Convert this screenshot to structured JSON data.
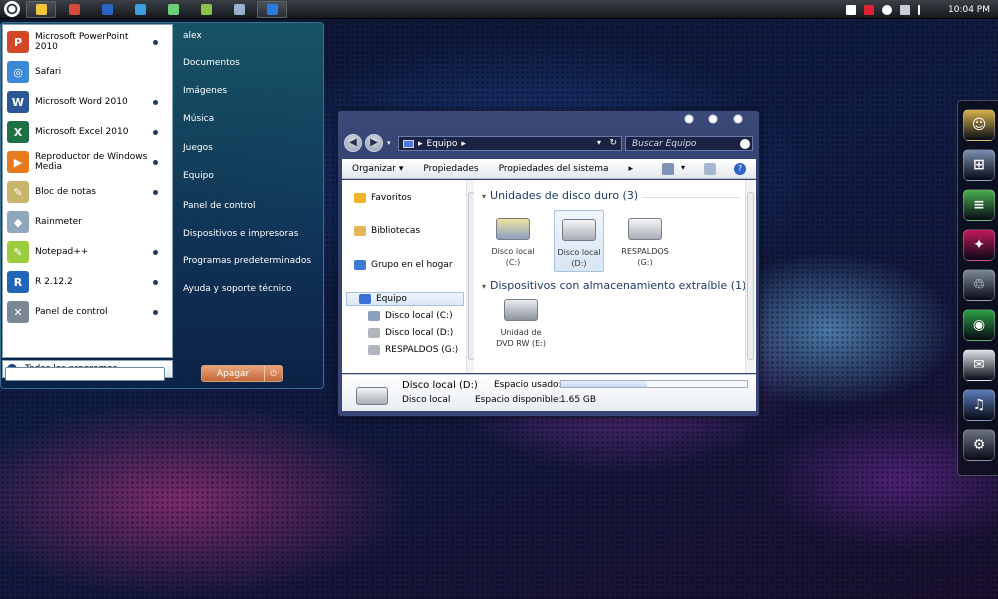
{
  "taskbar": {
    "buttons": [
      {
        "name": "taskbar-notes-button",
        "color": "#f2c73a",
        "active": true
      },
      {
        "name": "taskbar-paint-button",
        "color": "#d24a3a",
        "active": false
      },
      {
        "name": "taskbar-photoshop-button",
        "color": "#2a64c4",
        "active": false
      },
      {
        "name": "taskbar-vector-button",
        "color": "#3aa0e0",
        "active": false
      },
      {
        "name": "taskbar-math-button",
        "color": "#6ad07a",
        "active": false
      },
      {
        "name": "taskbar-tool-button",
        "color": "#8bc34a",
        "active": false
      },
      {
        "name": "taskbar-dots-button",
        "color": "#9ab0d0",
        "active": false
      },
      {
        "name": "taskbar-ps-button",
        "color": "#2a7de0",
        "active": true
      }
    ],
    "clock": "10:04 PM"
  },
  "start_menu": {
    "programs": [
      {
        "label": "Microsoft PowerPoint 2010",
        "icon": "powerpoint-icon",
        "glyph": "P",
        "color": "#d24726",
        "arrow": true
      },
      {
        "label": "Safari",
        "icon": "safari-icon",
        "glyph": "◎",
        "color": "#3d88d6",
        "arrow": false
      },
      {
        "label": "Microsoft Word 2010",
        "icon": "word-icon",
        "glyph": "W",
        "color": "#2b5797",
        "arrow": true
      },
      {
        "label": "Microsoft Excel 2010",
        "icon": "excel-icon",
        "glyph": "X",
        "color": "#1e7145",
        "arrow": true
      },
      {
        "label": "Reproductor de Windows Media",
        "icon": "media-player-icon",
        "glyph": "▶",
        "color": "#e87a1e",
        "arrow": true
      },
      {
        "label": "Bloc de notas",
        "icon": "notepad-icon",
        "glyph": "✎",
        "color": "#c9b56a",
        "arrow": true
      },
      {
        "label": "Rainmeter",
        "icon": "rainmeter-icon",
        "glyph": "◆",
        "color": "#8fa6bd",
        "arrow": false
      },
      {
        "label": "Notepad++",
        "icon": "notepadpp-icon",
        "glyph": "✎",
        "color": "#9ccc3c",
        "arrow": true
      },
      {
        "label": "R 2.12.2",
        "icon": "r-icon",
        "glyph": "R",
        "color": "#2065b8",
        "arrow": true
      },
      {
        "label": "Panel de control",
        "icon": "tools-icon",
        "glyph": "✕",
        "color": "#7c8794",
        "arrow": true
      }
    ],
    "all_programs": "Todos los programas",
    "places": [
      "alex",
      "Documentos",
      "Imágenes",
      "Música",
      "Juegos",
      "Equipo",
      "Panel de control",
      "Dispositivos e impresoras",
      "Programas predeterminados",
      "Ayuda y soporte técnico"
    ],
    "shutdown": "Apagar"
  },
  "explorer": {
    "address": "Equipo",
    "search_placeholder": "Buscar Equipo",
    "toolbar": [
      "Organizar",
      "Propiedades",
      "Propiedades del sistema"
    ],
    "nav": [
      {
        "label": "Favoritos",
        "icon": "star-icon",
        "color": "#f0b429",
        "sub": false,
        "sel": false
      },
      {
        "label": "Bibliotecas",
        "icon": "library-icon",
        "color": "#e7b45a",
        "sub": false,
        "sel": false
      },
      {
        "label": "Grupo en el hogar",
        "icon": "homegroup-icon",
        "color": "#3d7ad6",
        "sub": false,
        "sel": false
      },
      {
        "label": "Equipo",
        "icon": "computer-icon",
        "color": "#3d6fd6",
        "sub": false,
        "sel": true
      },
      {
        "label": "Disco local (C:)",
        "icon": "drive-icon",
        "color": "#8aa0c0",
        "sub": true,
        "sel": false
      },
      {
        "label": "Disco local (D:)",
        "icon": "drive-icon",
        "color": "#b0b6be",
        "sub": true,
        "sel": false
      },
      {
        "label": "RESPALDOS (G:)",
        "icon": "drive-icon",
        "color": "#b0b6be",
        "sub": true,
        "sel": false
      }
    ],
    "group_hdd": "Unidades de disco duro (3)",
    "group_removable": "Dispositivos con almacenamiento extraíble (1)",
    "drives": [
      {
        "label": "Disco local (C:)",
        "sel": false
      },
      {
        "label": "Disco local (D:)",
        "sel": true
      },
      {
        "label": "RESPALDOS (G:)",
        "sel": false
      }
    ],
    "dvd": "Unidad de DVD RW (E:)",
    "details": {
      "name": "Disco local (D:)",
      "type": "Disco local",
      "used_label": "Espacio usado:",
      "free_label": "Espacio disponible:",
      "free_value": "1.65 GB",
      "used_fraction": 0.46
    }
  },
  "dock": [
    {
      "name": "dock-person-icon",
      "color": "#d9b24c",
      "glyph": "☺"
    },
    {
      "name": "dock-windows-icon",
      "color": "#7a8fb0",
      "glyph": "⊞"
    },
    {
      "name": "dock-books-icon",
      "color": "#4caf50",
      "glyph": "≡"
    },
    {
      "name": "dock-photo-icon",
      "color": "#c2185b",
      "glyph": "✦"
    },
    {
      "name": "dock-recycle-bin-icon",
      "color": "#7d8a98",
      "glyph": "♲"
    },
    {
      "name": "dock-chrome-icon",
      "color": "#2e9e45",
      "glyph": "◉"
    },
    {
      "name": "dock-mail-icon",
      "color": "#e0e3e8",
      "glyph": "✉"
    },
    {
      "name": "dock-itunes-icon",
      "color": "#5c7dbb",
      "glyph": "♫"
    },
    {
      "name": "dock-settings-icon",
      "color": "#6b737e",
      "glyph": "⚙"
    }
  ]
}
